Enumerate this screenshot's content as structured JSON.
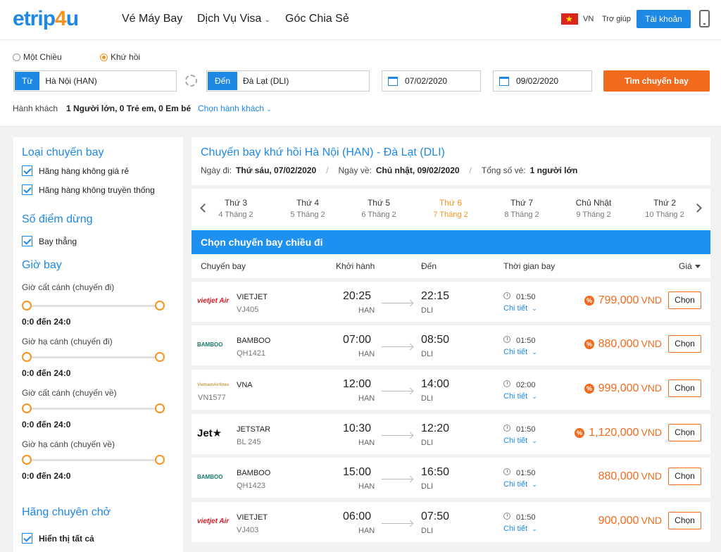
{
  "header": {
    "logo": {
      "e": "e",
      "trip": "trip",
      "four": "4",
      "u": "u"
    },
    "nav": [
      {
        "label": "Vé Máy Bay"
      },
      {
        "label": "Dịch Vụ Visa"
      },
      {
        "label": "Góc Chia Sẻ"
      }
    ],
    "lang": "VN",
    "help": "Trợ giúp",
    "account": "Tài khoản",
    "colors": {
      "primary": "#1e88e5",
      "accent": "#f26b1d"
    }
  },
  "search": {
    "trip_types": [
      {
        "label": "Một Chiều",
        "selected": false
      },
      {
        "label": "Khứ hồi",
        "selected": true
      }
    ],
    "from_tag": "Từ",
    "from_value": "Hà Nội (HAN)",
    "to_tag": "Đến",
    "to_value": "Đà Lạt (DLI)",
    "depart_date": "07/02/2020",
    "return_date": "09/02/2020",
    "search_button": "Tìm chuyến bay",
    "pax_label": "Hành khách",
    "pax_value": "1 Người lớn, 0 Trẻ em, 0 Em bé",
    "pax_choose": "Chọn hành khách"
  },
  "sidebar": {
    "flight_type_title": "Loại chuyến bay",
    "flight_types": [
      "Hãng hàng không giá rẻ",
      "Hãng hàng không truyền thống"
    ],
    "stops_title": "Số điểm dừng",
    "stops": [
      "Bay thẳng"
    ],
    "time_title": "Giờ bay",
    "time_filters": [
      {
        "label": "Giờ cất cánh (chuyến đi)",
        "range": "0:0 đến 24:0"
      },
      {
        "label": "Giờ hạ cánh (chuyến đi)",
        "range": "0:0 đến 24:0"
      },
      {
        "label": "Giờ cất cánh (chuyến về)",
        "range": "0:0 đến 24:0"
      },
      {
        "label": "Giờ hạ cánh (chuyến về)",
        "range": "0:0 đến 24:0"
      }
    ],
    "carrier_title": "Hãng chuyên chở",
    "carrier_all": "Hiển thị tất cả"
  },
  "main": {
    "title": "Chuyến bay khứ hồi Hà Nội (HAN) - Đà Lạt (DLI)",
    "depart_label": "Ngày đi:",
    "depart_value": "Thứ sáu, 07/02/2020",
    "return_label": "Ngày về:",
    "return_value": "Chủ nhật, 09/02/2020",
    "tickets_label": "Tổng số vé:",
    "tickets_value": "1 người lớn",
    "days": [
      {
        "day": "Thứ 3",
        "date": "4 Tháng 2",
        "active": false
      },
      {
        "day": "Thứ 4",
        "date": "5 Tháng 2",
        "active": false
      },
      {
        "day": "Thứ 5",
        "date": "6 Tháng 2",
        "active": false
      },
      {
        "day": "Thứ 6",
        "date": "7 Tháng 2",
        "active": true
      },
      {
        "day": "Thứ 7",
        "date": "8 Tháng 2",
        "active": false
      },
      {
        "day": "Chủ Nhật",
        "date": "9 Tháng 2",
        "active": false
      },
      {
        "day": "Thứ 2",
        "date": "10 Tháng 2",
        "active": false
      }
    ],
    "section_title": "Chọn chuyến bay chiều đi",
    "columns": {
      "flight": "Chuyến bay",
      "depart": "Khởi hành",
      "arrive": "Đến",
      "duration": "Thời gian bay",
      "price": "Giá"
    },
    "flights": [
      {
        "logo": "vietjet Air",
        "airline": "VIETJET",
        "code": "VJ405",
        "dep": "20:25",
        "dep_ap": "HAN",
        "arr": "22:15",
        "arr_ap": "DLI",
        "dur": "01:50",
        "detail": "Chi tiết",
        "promo": true,
        "price": "799,000",
        "cur": "VND",
        "choose": "Chọn"
      },
      {
        "logo": "BAMBOO",
        "airline": "BAMBOO",
        "code": "QH1421",
        "dep": "07:00",
        "dep_ap": "HAN",
        "arr": "08:50",
        "arr_ap": "DLI",
        "dur": "01:50",
        "detail": "Chi tiết",
        "promo": true,
        "price": "880,000",
        "cur": "VND",
        "choose": "Chọn"
      },
      {
        "logo": "VietnamAirlines",
        "airline": "VNA",
        "code": "VN1577",
        "dep": "12:00",
        "dep_ap": "HAN",
        "arr": "14:00",
        "arr_ap": "DLI",
        "dur": "02:00",
        "detail": "Chi tiết",
        "promo": true,
        "price": "999,000",
        "cur": "VND",
        "choose": "Chọn"
      },
      {
        "logo": "Jet★",
        "airline": "JETSTAR",
        "code": "BL 245",
        "dep": "10:30",
        "dep_ap": "HAN",
        "arr": "12:20",
        "arr_ap": "DLI",
        "dur": "01:50",
        "detail": "Chi tiết",
        "promo": true,
        "price": "1,120,000",
        "cur": "VND",
        "choose": "Chọn"
      },
      {
        "logo": "BAMBOO",
        "airline": "BAMBOO",
        "code": "QH1423",
        "dep": "15:00",
        "dep_ap": "HAN",
        "arr": "16:50",
        "arr_ap": "DLI",
        "dur": "01:50",
        "detail": "Chi tiết",
        "promo": false,
        "price": "880,000",
        "cur": "VND",
        "choose": "Chọn"
      },
      {
        "logo": "vietjet Air",
        "airline": "VIETJET",
        "code": "VJ403",
        "dep": "06:00",
        "dep_ap": "HAN",
        "arr": "07:50",
        "arr_ap": "DLI",
        "dur": "01:50",
        "detail": "Chi tiết",
        "promo": false,
        "price": "900,000",
        "cur": "VND",
        "choose": "Chọn"
      }
    ]
  }
}
